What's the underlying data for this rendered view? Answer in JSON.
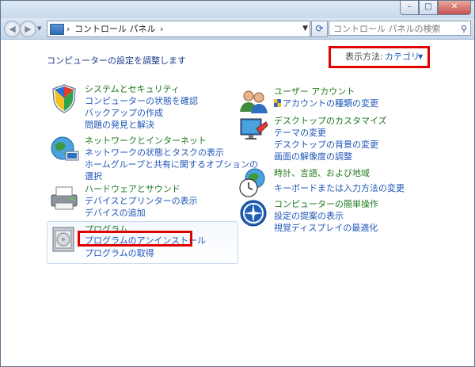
{
  "window": {
    "caption_buttons": [
      "–",
      "□",
      "✕"
    ]
  },
  "navbar": {
    "address_segments": [
      "›",
      "コントロール パネル",
      "›"
    ],
    "search_placeholder": "コントロール パネルの検索"
  },
  "header": {
    "heading": "コンピューターの設定を調整します",
    "view_label": "表示方法:",
    "view_value": "カテゴリ"
  },
  "categories": [
    {
      "title": "システムとセキュリティ",
      "links": [
        "コンピューターの状態を確認",
        "バックアップの作成",
        "問題の発見と解決"
      ]
    },
    {
      "title": "ネットワークとインターネット",
      "links": [
        "ネットワークの状態とタスクの表示",
        "ホームグループと共有に関するオプションの",
        "選択"
      ]
    },
    {
      "title": "ハードウェアとサウンド",
      "links": [
        "デバイスとプリンターの表示",
        "デバイスの追加"
      ]
    },
    {
      "title": "プログラム",
      "links": [
        "プログラムのアンインストール",
        "プログラムの取得"
      ]
    },
    {
      "title": "ユーザー アカウント",
      "links": [
        "アカウントの種類の変更"
      ]
    },
    {
      "title": "デスクトップのカスタマイズ",
      "links": [
        "テーマの変更",
        "デスクトップの背景の変更",
        "画面の解像度の調整"
      ]
    },
    {
      "title": "時計、言語、および地域",
      "links": [
        "キーボードまたは入力方法の変更"
      ]
    },
    {
      "title": "コンピューターの簡単操作",
      "links": [
        "設定の提案の表示",
        "視覚ディスプレイの最適化"
      ]
    }
  ]
}
